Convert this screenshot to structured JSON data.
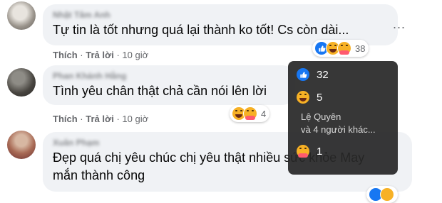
{
  "comments": [
    {
      "author": "Nhật Tâm Anh",
      "text": "Tự tin là tốt nhưng quá lại thành ko tốt! Cs còn dài...",
      "actions": {
        "like": "Thích",
        "reply": "Trả lời",
        "time": "10 giờ"
      },
      "reaction_count": "38"
    },
    {
      "author": "Phan Khánh Hằng",
      "text": "Tình yêu chân thật chả cần nói lên lời",
      "actions": {
        "like": "Thích",
        "reply": "Trả lời",
        "time": "10 giờ"
      },
      "reaction_count": "4"
    },
    {
      "author": "Xuân Phạm",
      "text_line1": "Đẹp quá chị yêu chúc chị yêu thật nhiều sức khỏe May",
      "text_line2": "mắn thành công"
    }
  ],
  "more_button": "...",
  "tooltip": {
    "like_count": "32",
    "haha_count": "5",
    "haha_name": "Lệ Quyên",
    "haha_more": "và 4 người khác...",
    "care_count": "1"
  },
  "icons": {
    "like": "like-icon",
    "haha": "haha-icon",
    "care": "care-icon",
    "more": "more-options-icon"
  },
  "colors": {
    "like": "#1877f2",
    "haha": "#f7b125",
    "bubble": "#f0f2f5"
  }
}
